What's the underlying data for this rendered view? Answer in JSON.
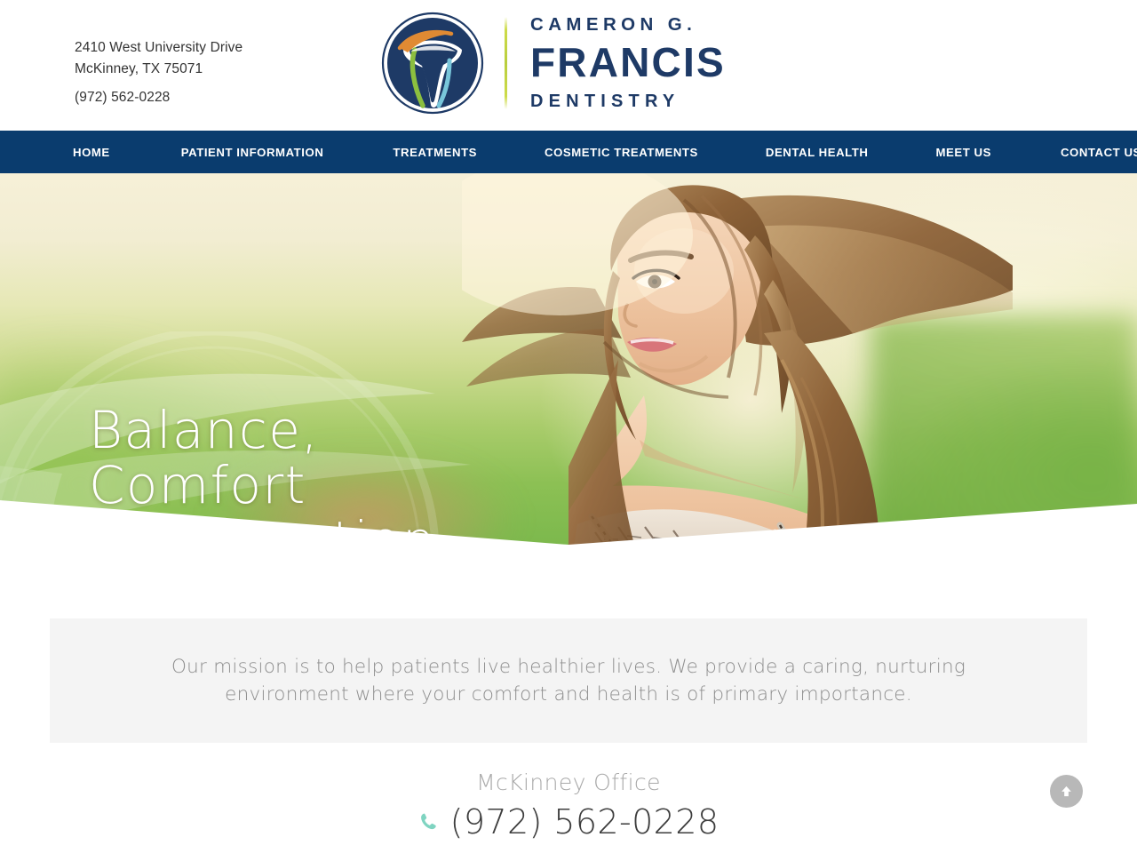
{
  "header": {
    "address_line1": "2410 West University Drive",
    "address_line2": "McKinney, TX 75071",
    "phone": "(972) 562-0228",
    "logo": {
      "icon": "tooth-circle-logo",
      "line1": "CAMERON G.",
      "line2": "FRANCIS",
      "line3": "DENTISTRY",
      "navy": "#1e3a66",
      "green": "#8cbf3f",
      "orange": "#e08a33",
      "lightblue": "#79c6da",
      "divider_color": "#cddb49"
    }
  },
  "nav": {
    "background": "#0a3c6e",
    "items": [
      {
        "label": "HOME"
      },
      {
        "label": "PATIENT INFORMATION"
      },
      {
        "label": "TREATMENTS"
      },
      {
        "label": "COSMETIC TREATMENTS"
      },
      {
        "label": "DENTAL HEALTH"
      },
      {
        "label": "MEET US"
      },
      {
        "label": "CONTACT US"
      }
    ]
  },
  "hero": {
    "title_line1": "Balance,",
    "title_line2": "Comfort",
    "title_line3": "and Function",
    "image_alt": "smiling-woman-in-field"
  },
  "mission": {
    "text": "Our mission is to help patients live healthier lives. We provide a caring, nurturing environment where your comfort and health is of primary importance.",
    "background": "#f4f4f4",
    "text_color": "#8e8e8e"
  },
  "footer": {
    "office_label": "McKinney Office",
    "phone": "(972) 562-0228",
    "phone_icon": "phone-icon",
    "phone_icon_color": "#7fd4c1"
  },
  "scroll_top": {
    "icon": "arrow-up-icon",
    "background": "#b8b8b8"
  }
}
